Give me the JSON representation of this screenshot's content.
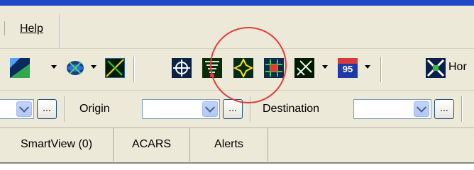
{
  "menubar": {
    "items": [
      {
        "label": "Help"
      }
    ]
  },
  "toolbar1": {
    "icons": [
      "map-layer-icon",
      "weather-globe-icon",
      "route-overlay-icon",
      "target-icon",
      "filter-icon",
      "star-compass-icon",
      "grid-overlay-icon",
      "airway-icon",
      "interstate-95-icon",
      "home-icon"
    ],
    "interstate_label": "95",
    "home_label": "Hor"
  },
  "toolbar2": {
    "origin_label": "Origin",
    "destination_label": "Destination",
    "dots_label": "..."
  },
  "tabs": [
    {
      "label": "SmartView (0)"
    },
    {
      "label": "ACARS"
    },
    {
      "label": "Alerts"
    }
  ],
  "colors": {
    "titlebar": "#1f49c9",
    "chrome": "#ece9d8",
    "annotation": "#e53b3b"
  }
}
